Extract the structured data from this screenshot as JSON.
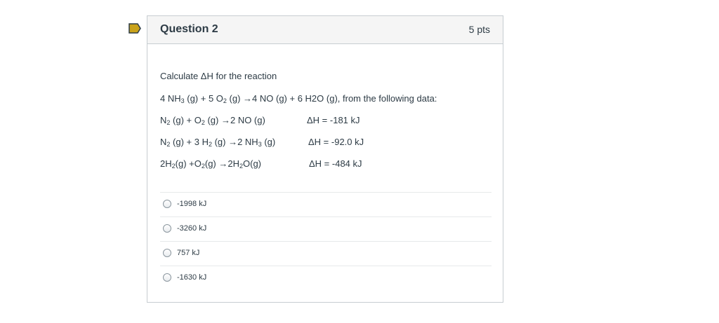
{
  "question": {
    "title": "Question 2",
    "points": "5 pts",
    "intro": "Calculate ΔH for the reaction",
    "flag_color": "#c9a21a"
  },
  "reaction": {
    "p1": "4 NH",
    "s1": "3",
    "p2": " (g) + 5 O",
    "s2": "2",
    "p3": " (g) →4 NO (g) + 6 H2O (g), from the following data:"
  },
  "data_rows": [
    {
      "parts": [
        "N",
        "2",
        " (g) + O",
        "2",
        " (g) →2 NO (g)"
      ],
      "dh": "ΔH = -181 kJ"
    },
    {
      "parts": [
        "N",
        "2",
        " (g) + 3 H",
        "2",
        " (g) →2 NH",
        "3",
        " (g)"
      ],
      "dh": "ΔH = -92.0 kJ"
    },
    {
      "parts": [
        "2H",
        "2",
        "(g) +O",
        "2",
        "(g) →2H",
        "2",
        "O(g)"
      ],
      "dh": "ΔH = -484 kJ"
    }
  ],
  "answers": [
    {
      "label": "-1998 kJ"
    },
    {
      "label": "-3260 kJ"
    },
    {
      "label": "757 kJ"
    },
    {
      "label": "-1630 kJ"
    }
  ]
}
